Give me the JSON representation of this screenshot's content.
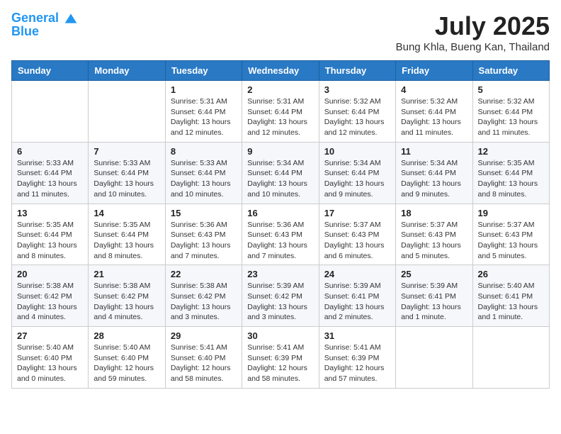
{
  "header": {
    "logo_line1": "General",
    "logo_line2": "Blue",
    "month": "July 2025",
    "location": "Bung Khla, Bueng Kan, Thailand"
  },
  "weekdays": [
    "Sunday",
    "Monday",
    "Tuesday",
    "Wednesday",
    "Thursday",
    "Friday",
    "Saturday"
  ],
  "weeks": [
    [
      null,
      null,
      {
        "day": 1,
        "sunrise": "5:31 AM",
        "sunset": "6:44 PM",
        "daylight": "13 hours and 12 minutes."
      },
      {
        "day": 2,
        "sunrise": "5:31 AM",
        "sunset": "6:44 PM",
        "daylight": "13 hours and 12 minutes."
      },
      {
        "day": 3,
        "sunrise": "5:32 AM",
        "sunset": "6:44 PM",
        "daylight": "13 hours and 12 minutes."
      },
      {
        "day": 4,
        "sunrise": "5:32 AM",
        "sunset": "6:44 PM",
        "daylight": "13 hours and 11 minutes."
      },
      {
        "day": 5,
        "sunrise": "5:32 AM",
        "sunset": "6:44 PM",
        "daylight": "13 hours and 11 minutes."
      }
    ],
    [
      {
        "day": 6,
        "sunrise": "5:33 AM",
        "sunset": "6:44 PM",
        "daylight": "13 hours and 11 minutes."
      },
      {
        "day": 7,
        "sunrise": "5:33 AM",
        "sunset": "6:44 PM",
        "daylight": "13 hours and 10 minutes."
      },
      {
        "day": 8,
        "sunrise": "5:33 AM",
        "sunset": "6:44 PM",
        "daylight": "13 hours and 10 minutes."
      },
      {
        "day": 9,
        "sunrise": "5:34 AM",
        "sunset": "6:44 PM",
        "daylight": "13 hours and 10 minutes."
      },
      {
        "day": 10,
        "sunrise": "5:34 AM",
        "sunset": "6:44 PM",
        "daylight": "13 hours and 9 minutes."
      },
      {
        "day": 11,
        "sunrise": "5:34 AM",
        "sunset": "6:44 PM",
        "daylight": "13 hours and 9 minutes."
      },
      {
        "day": 12,
        "sunrise": "5:35 AM",
        "sunset": "6:44 PM",
        "daylight": "13 hours and 8 minutes."
      }
    ],
    [
      {
        "day": 13,
        "sunrise": "5:35 AM",
        "sunset": "6:44 PM",
        "daylight": "13 hours and 8 minutes."
      },
      {
        "day": 14,
        "sunrise": "5:35 AM",
        "sunset": "6:44 PM",
        "daylight": "13 hours and 8 minutes."
      },
      {
        "day": 15,
        "sunrise": "5:36 AM",
        "sunset": "6:43 PM",
        "daylight": "13 hours and 7 minutes."
      },
      {
        "day": 16,
        "sunrise": "5:36 AM",
        "sunset": "6:43 PM",
        "daylight": "13 hours and 7 minutes."
      },
      {
        "day": 17,
        "sunrise": "5:37 AM",
        "sunset": "6:43 PM",
        "daylight": "13 hours and 6 minutes."
      },
      {
        "day": 18,
        "sunrise": "5:37 AM",
        "sunset": "6:43 PM",
        "daylight": "13 hours and 5 minutes."
      },
      {
        "day": 19,
        "sunrise": "5:37 AM",
        "sunset": "6:43 PM",
        "daylight": "13 hours and 5 minutes."
      }
    ],
    [
      {
        "day": 20,
        "sunrise": "5:38 AM",
        "sunset": "6:42 PM",
        "daylight": "13 hours and 4 minutes."
      },
      {
        "day": 21,
        "sunrise": "5:38 AM",
        "sunset": "6:42 PM",
        "daylight": "13 hours and 4 minutes."
      },
      {
        "day": 22,
        "sunrise": "5:38 AM",
        "sunset": "6:42 PM",
        "daylight": "13 hours and 3 minutes."
      },
      {
        "day": 23,
        "sunrise": "5:39 AM",
        "sunset": "6:42 PM",
        "daylight": "13 hours and 3 minutes."
      },
      {
        "day": 24,
        "sunrise": "5:39 AM",
        "sunset": "6:41 PM",
        "daylight": "13 hours and 2 minutes."
      },
      {
        "day": 25,
        "sunrise": "5:39 AM",
        "sunset": "6:41 PM",
        "daylight": "13 hours and 1 minute."
      },
      {
        "day": 26,
        "sunrise": "5:40 AM",
        "sunset": "6:41 PM",
        "daylight": "13 hours and 1 minute."
      }
    ],
    [
      {
        "day": 27,
        "sunrise": "5:40 AM",
        "sunset": "6:40 PM",
        "daylight": "13 hours and 0 minutes."
      },
      {
        "day": 28,
        "sunrise": "5:40 AM",
        "sunset": "6:40 PM",
        "daylight": "12 hours and 59 minutes."
      },
      {
        "day": 29,
        "sunrise": "5:41 AM",
        "sunset": "6:40 PM",
        "daylight": "12 hours and 58 minutes."
      },
      {
        "day": 30,
        "sunrise": "5:41 AM",
        "sunset": "6:39 PM",
        "daylight": "12 hours and 58 minutes."
      },
      {
        "day": 31,
        "sunrise": "5:41 AM",
        "sunset": "6:39 PM",
        "daylight": "12 hours and 57 minutes."
      },
      null,
      null
    ]
  ],
  "labels": {
    "sunrise": "Sunrise:",
    "sunset": "Sunset:",
    "daylight": "Daylight:"
  }
}
